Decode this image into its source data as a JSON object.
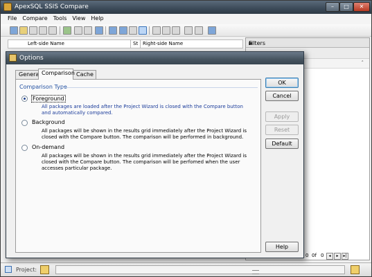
{
  "window": {
    "title": "ApexSQL SSIS Compare",
    "min": "–",
    "max": "□",
    "close": "✕"
  },
  "menu": [
    "File",
    "Compare",
    "Tools",
    "View",
    "Help"
  ],
  "grid": {
    "col_left": "Left-side Name",
    "col_status": "St",
    "col_right": "Right-side Name"
  },
  "filters": {
    "title": "Filters",
    "pin": "⩏",
    "close": "×",
    "arrow": "˄"
  },
  "pager": {
    "of": "0f",
    "zero": "0",
    "prev": "◂",
    "next": "▸",
    "last": "▸|"
  },
  "status": {
    "project_label": "Project:"
  },
  "dialog": {
    "title": "Options",
    "tabs": [
      "General",
      "Comparison",
      "Cache"
    ],
    "active_tab": "Comparison",
    "group_label": "Comparison Type",
    "options": [
      {
        "label": "Foreground",
        "checked": true,
        "description": "All packages are loaded after the Project Wizard is closed with the Compare button and automatically compared."
      },
      {
        "label": "Background",
        "checked": false,
        "description": "All packages will be shown in the results grid immediately after the Project Wizard is closed with the Compare button. The comparison will be performed in background."
      },
      {
        "label": "On-demand",
        "checked": false,
        "description": "All packages will be shown in the results grid immediately after the Project Wizard is closed with the Compare button. The comparison will be perfomed when the user accesses particular package."
      }
    ],
    "buttons": {
      "ok": "OK",
      "cancel": "Cancel",
      "apply": "Apply",
      "reset": "Reset",
      "default": "Default",
      "help": "Help"
    }
  }
}
